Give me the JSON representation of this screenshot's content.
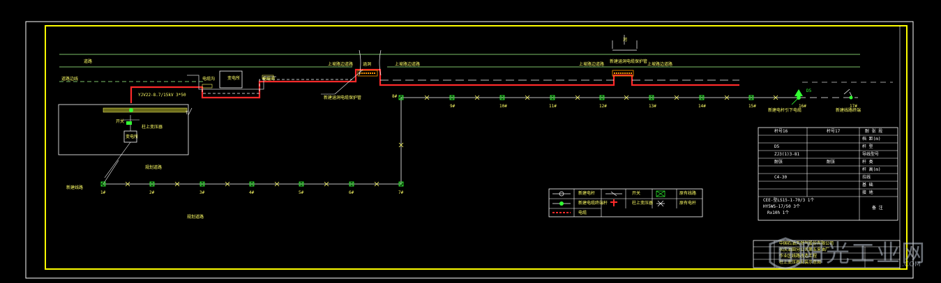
{
  "drawing": {
    "poles_bottom": [
      "1#",
      "2#",
      "3#",
      "4#",
      "5#",
      "6#",
      "7#"
    ],
    "poles_top": [
      "8#",
      "9#",
      "10#",
      "11#",
      "12#",
      "13#",
      "14#",
      "15#",
      "16#",
      "17#"
    ],
    "cable_spec": "YJV22-8.7/15kV 3*50",
    "t_label": "T",
    "box_labels": [
      "变电所",
      "开关"
    ],
    "elbow_labels": [
      "电缆沟",
      "电缆沟"
    ],
    "road_labels": [
      "道路",
      "道路边线",
      "上坡路边道路",
      "上坡路边道路",
      "上坡路边道路",
      "上坡路边道路"
    ],
    "bridge_labels": [
      "涵洞",
      "新建涵洞电缆保护管",
      "新建涵洞电缆保护管"
    ],
    "bracket_label": "河",
    "d5_label": "D5",
    "right_notes": [
      "新建电杆引下电缆",
      "新建线路终端"
    ],
    "bottom_notes": [
      "规划道路",
      "变电所",
      "新建线路"
    ],
    "legend": [
      {
        "label": "新建电杆"
      },
      {
        "label": "新建电缆终端杆"
      },
      {
        "label": "电缆"
      },
      {
        "label": "开关"
      },
      {
        "label": "柱上变压器"
      },
      {
        "label": "原有线路"
      },
      {
        "label": "原有电杆"
      }
    ],
    "table": {
      "headers": [
        "杆号16",
        "杆号17"
      ],
      "rows": [
        {
          "left": "",
          "mid": "",
          "right": "档   距(m)"
        },
        {
          "left": "D5",
          "mid": "",
          "right": "杆   型"
        },
        {
          "left": "ZJ3(1)3-81",
          "mid": "",
          "right": "导线型号"
        },
        {
          "left": "耐张",
          "mid": "耐张",
          "right": "杆   类"
        },
        {
          "left": "",
          "mid": "",
          "right": "杆   高(m)"
        },
        {
          "left": "C4-30",
          "mid": "",
          "right": "拉线"
        },
        {
          "left": "",
          "mid": "",
          "right": "基   础"
        },
        {
          "left": "",
          "mid": "",
          "right": "接   地"
        }
      ],
      "materials": [
        "CEE-型LS15-1-70/3 1个",
        "HY5WS-17/50 3个",
        "Rx10h 1个"
      ],
      "material_label": "备 注",
      "top_label": "耐 张 段"
    },
    "title_block": [
      "中国石油天然气股份有限公司",
      "长庆油田分公司第五采油厂",
      "作业区线路改造工程",
      "柱上变压器安装示意图"
    ]
  },
  "watermark": {
    "text": "阳光工业网",
    "sub": ".COM"
  },
  "colors": {
    "frame": "#ffff00",
    "road": "#a6ff8a",
    "cable": "#ff2a2a",
    "green": "#33ff33",
    "white": "#ffffff",
    "gray": "#9a9a9a"
  }
}
